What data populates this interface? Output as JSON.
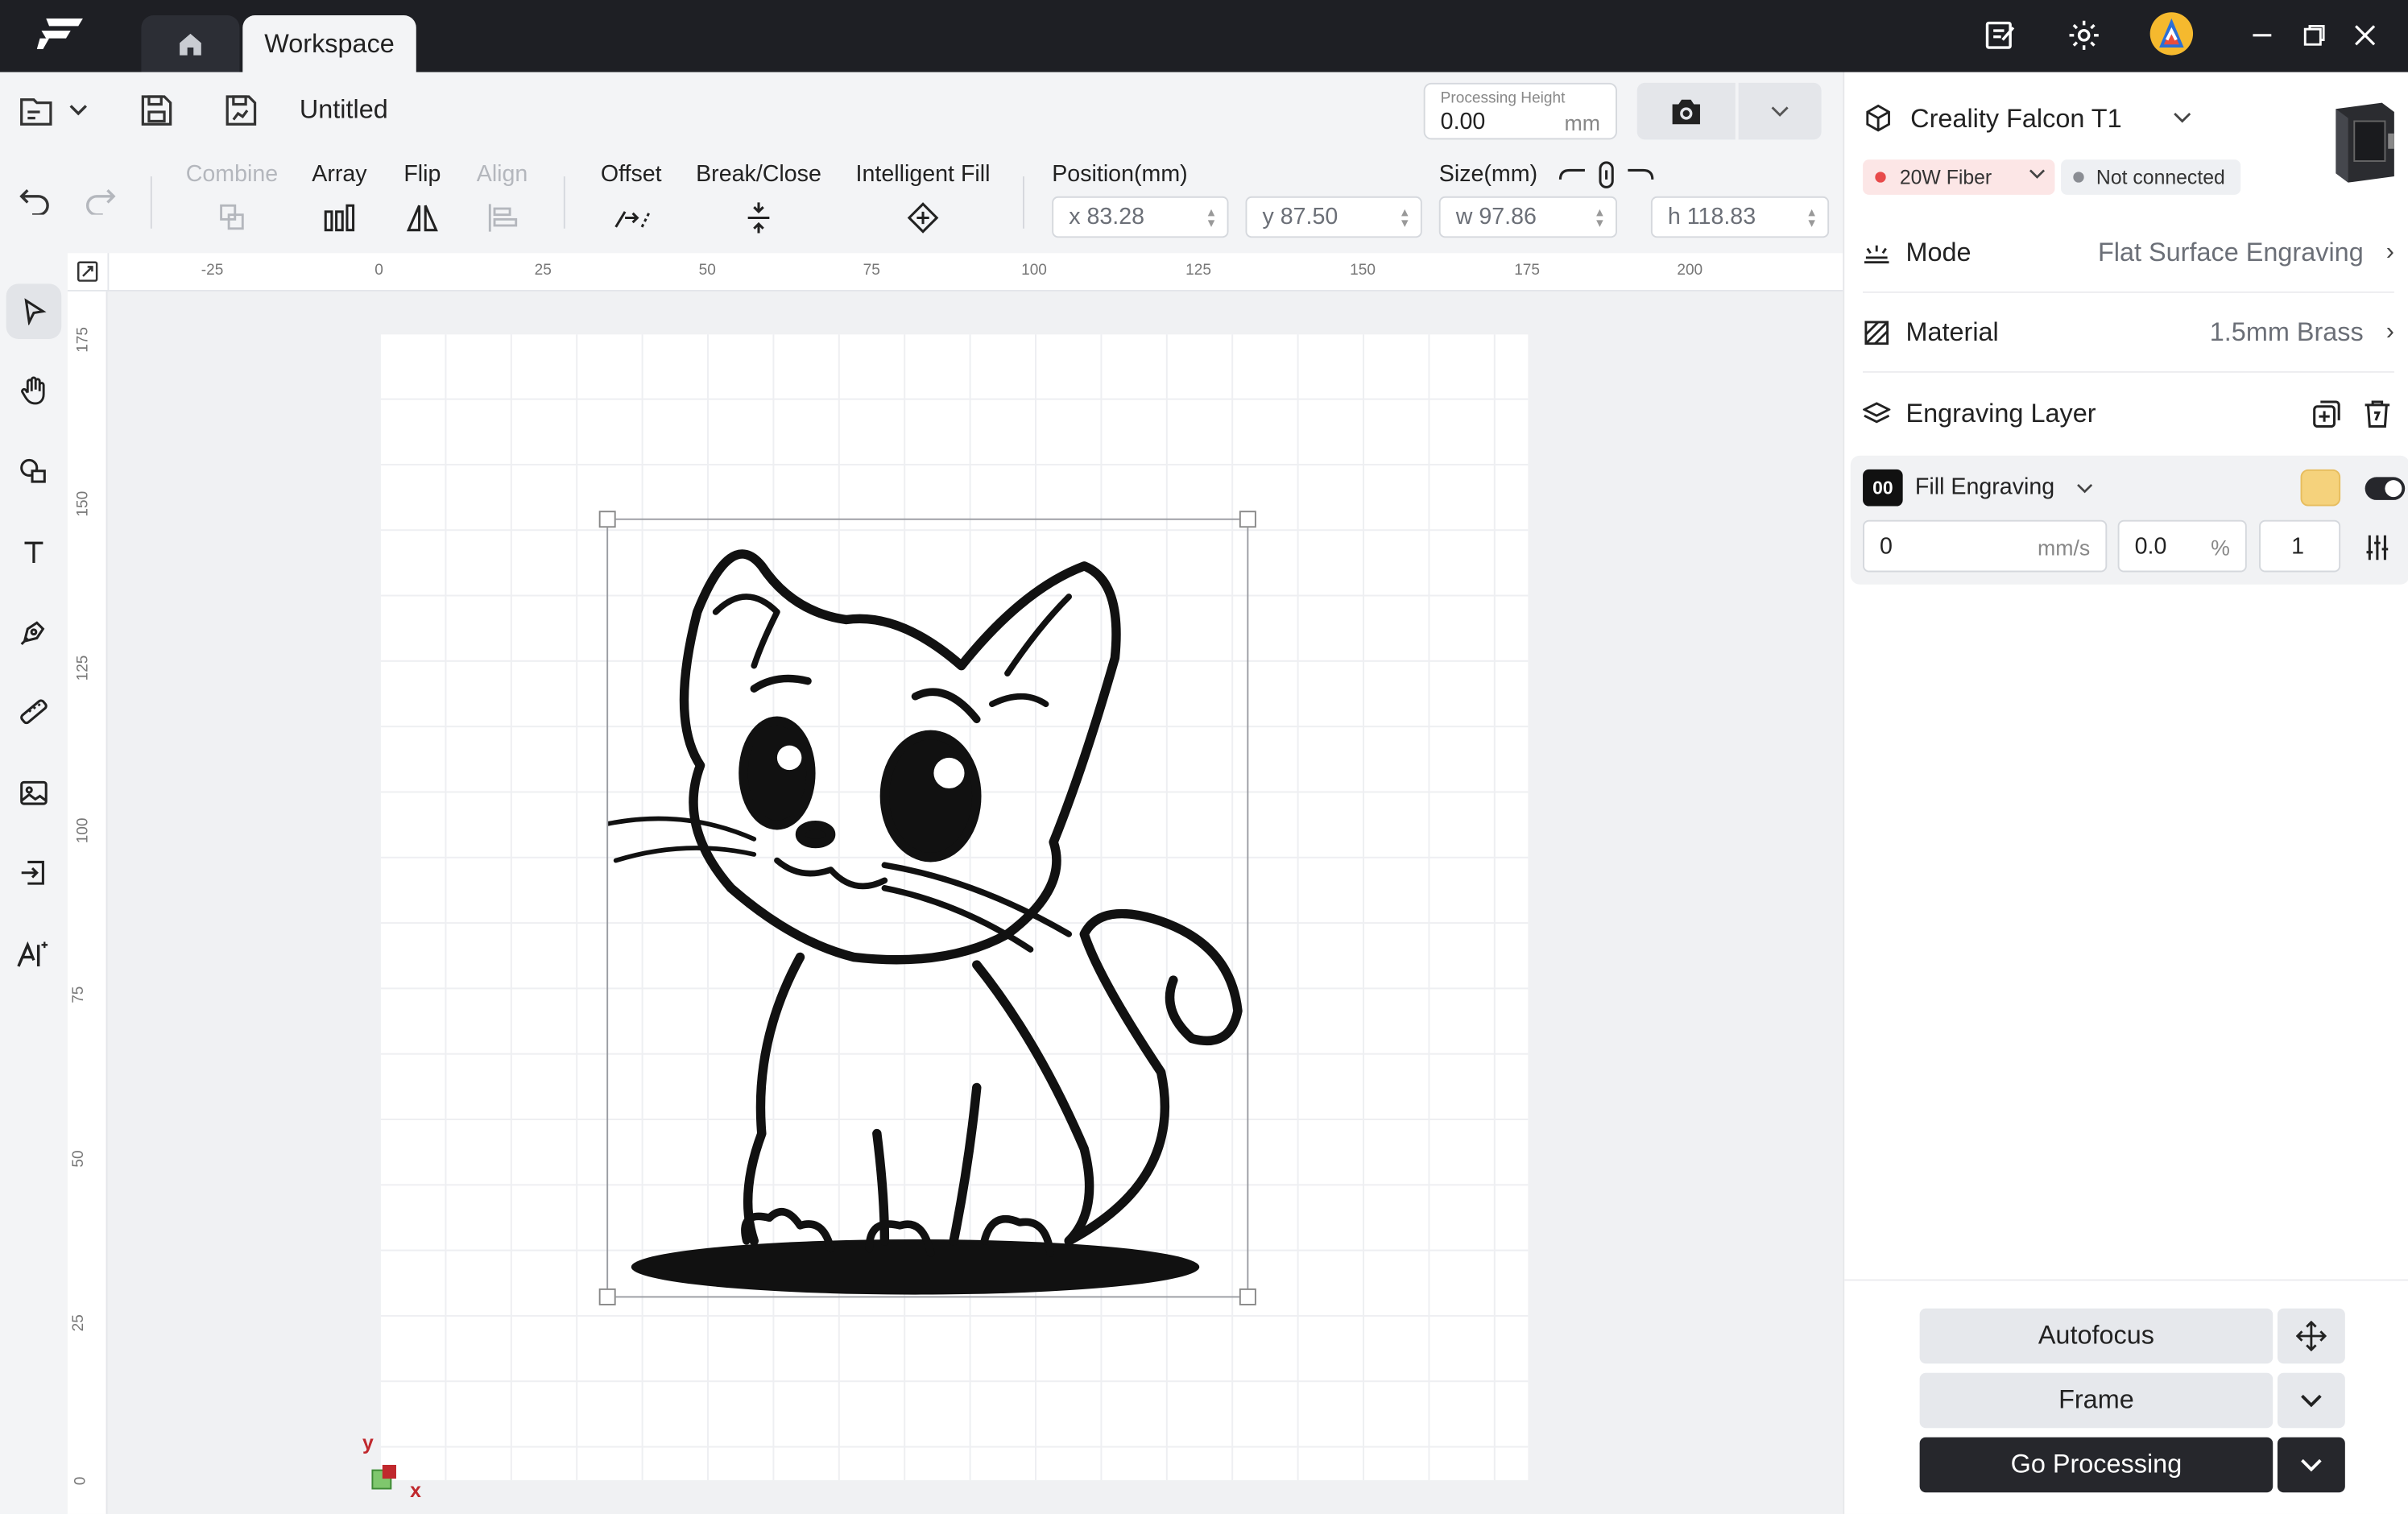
{
  "tabs": {
    "workspace": "Workspace"
  },
  "file": {
    "title": "Untitled"
  },
  "processing_height": {
    "label": "Processing Height",
    "value": "0.00",
    "unit": "mm"
  },
  "tools": {
    "combine": "Combine",
    "array": "Array",
    "flip": "Flip",
    "align": "Align",
    "offset": "Offset",
    "break_close": "Break/Close",
    "intelligent_fill": "Intelligent Fill"
  },
  "position": {
    "label": "Position(mm)",
    "x": "x 83.28",
    "y": "y 87.50"
  },
  "size": {
    "label": "Size(mm)",
    "w": "w 97.86",
    "h": "h 118.83"
  },
  "ruler": {
    "horizontal": [
      "-25",
      "0",
      "25",
      "50",
      "75",
      "100",
      "125",
      "150",
      "175",
      "200"
    ],
    "vertical": [
      "175",
      "150",
      "125",
      "100",
      "75",
      "50",
      "25",
      "0"
    ]
  },
  "axis": {
    "x": "x",
    "y": "y"
  },
  "device": {
    "name": "Creality Falcon T1",
    "laser": "20W Fiber",
    "status": "Not connected"
  },
  "settings": {
    "mode_label": "Mode",
    "mode_value": "Flat Surface Engraving",
    "material_label": "Material",
    "material_value": "1.5mm Brass",
    "layer_label": "Engraving Layer"
  },
  "layer": {
    "index": "00",
    "type": "Fill Engraving",
    "speed": "0",
    "speed_unit": "mm/s",
    "power": "0.0",
    "power_unit": "%",
    "passes": "1"
  },
  "actions": {
    "autofocus": "Autofocus",
    "frame": "Frame",
    "go": "Go Processing"
  },
  "colors": {
    "accent": "#26272c",
    "titlebar": "#1e1f24",
    "layer_swatch": "#f5d27c",
    "status_red": "#e84a4a"
  }
}
